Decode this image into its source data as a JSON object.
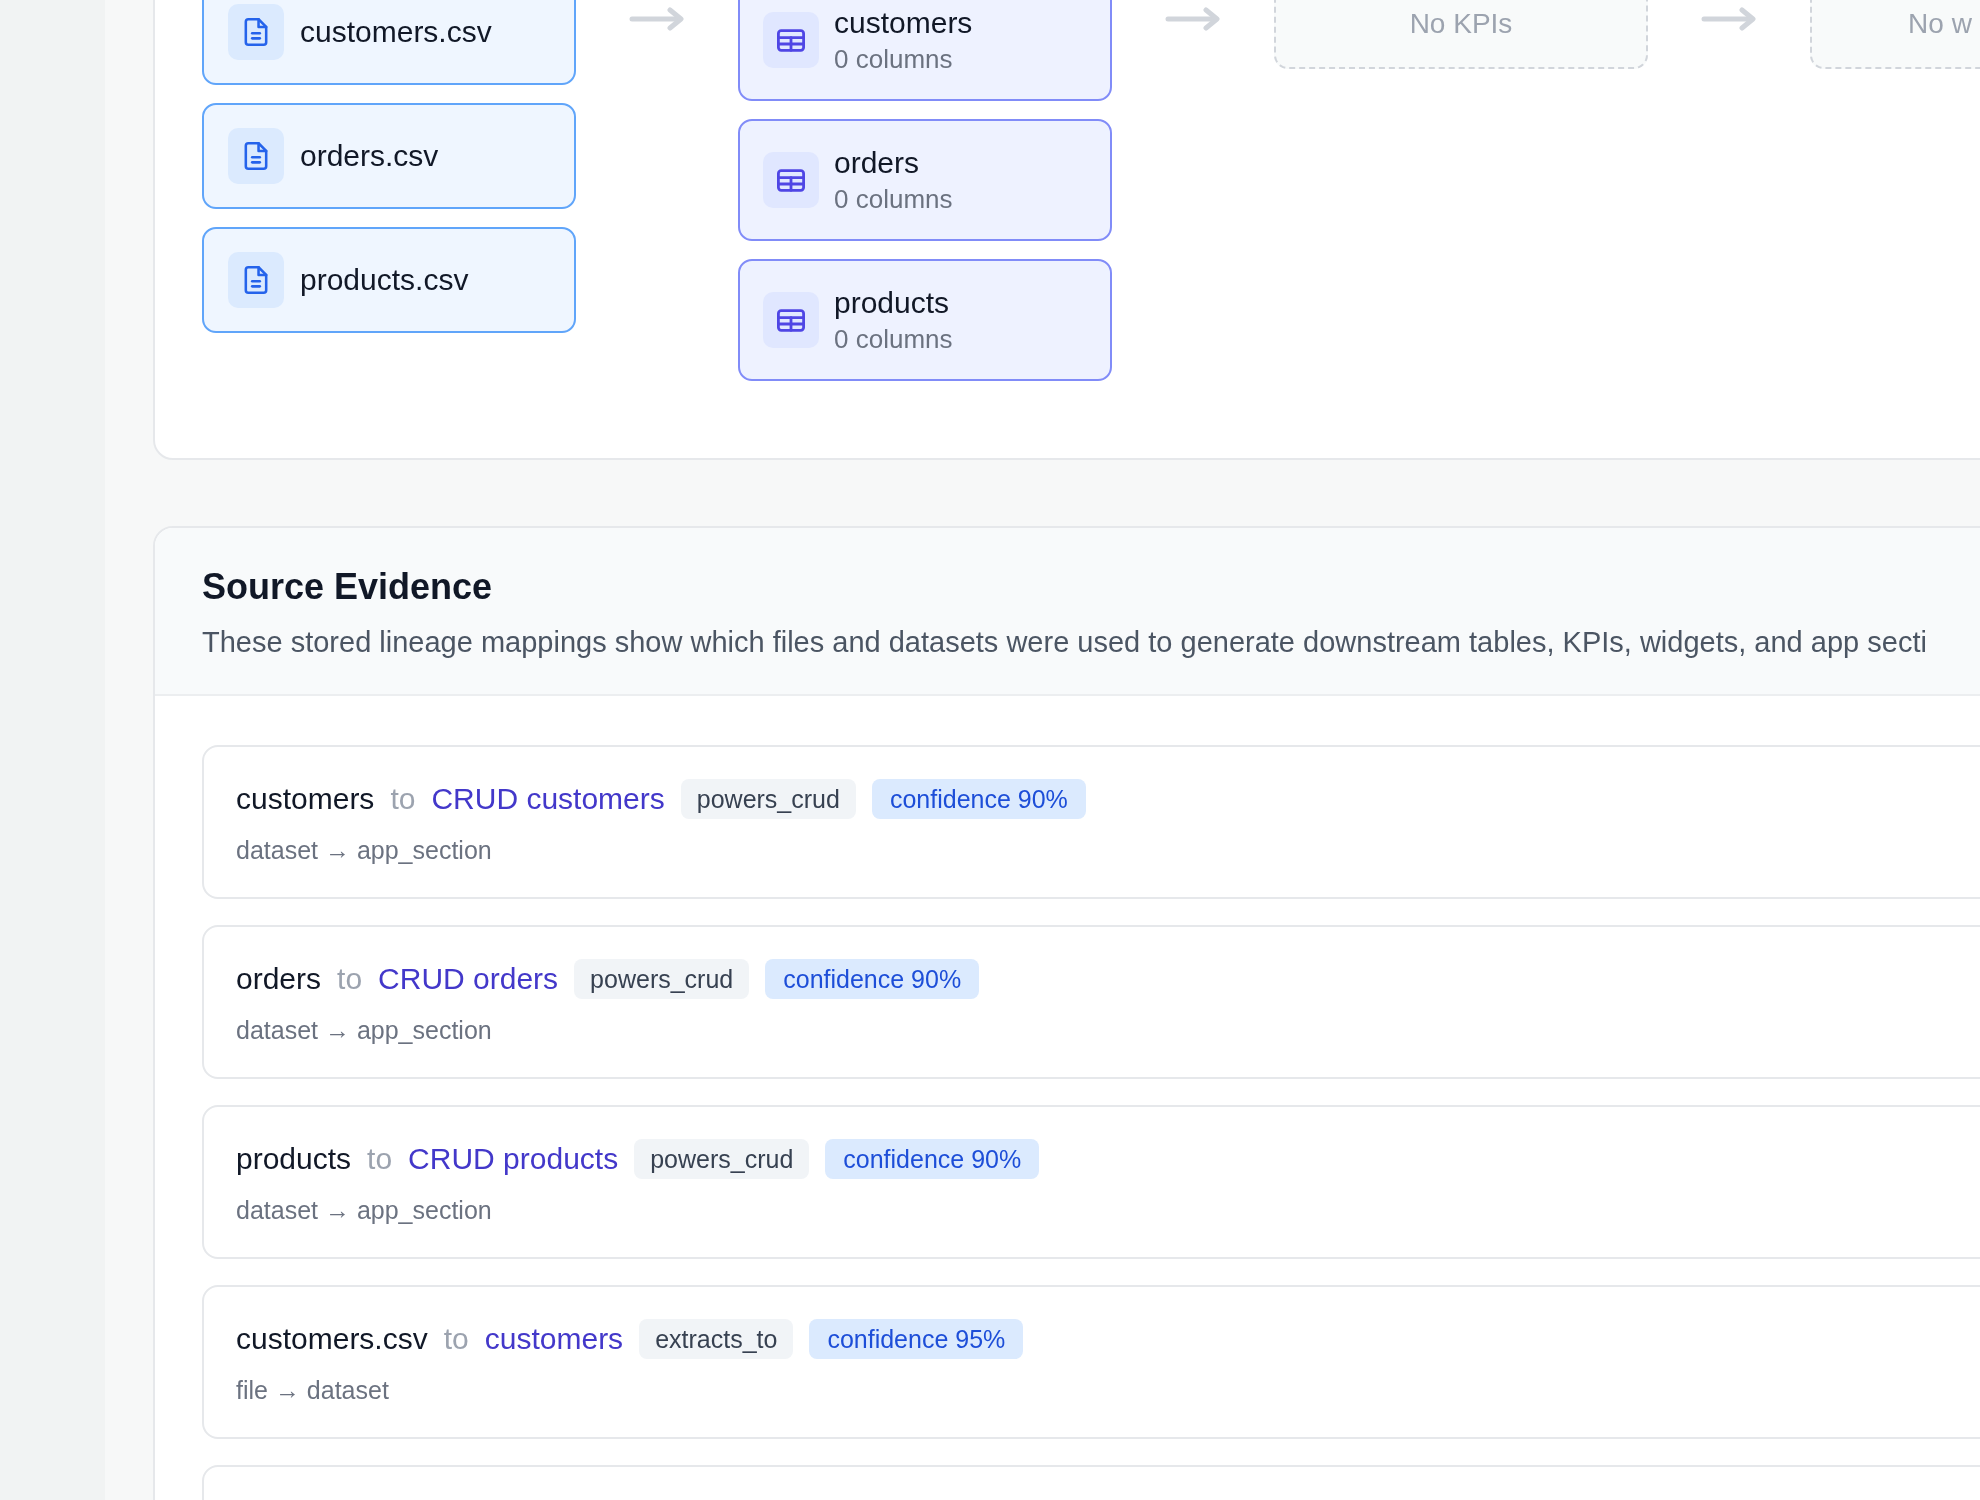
{
  "pipeline": {
    "columns": [
      {
        "kind": "files",
        "items": [
          {
            "label": "customers.csv"
          },
          {
            "label": "orders.csv"
          },
          {
            "label": "products.csv"
          }
        ]
      },
      {
        "kind": "datasets",
        "items": [
          {
            "label": "customers",
            "detail": "0 columns"
          },
          {
            "label": "orders",
            "detail": "0 columns"
          },
          {
            "label": "products",
            "detail": "0 columns"
          }
        ]
      },
      {
        "kind": "empty",
        "message": "No KPIs"
      },
      {
        "kind": "empty",
        "message": "No w"
      }
    ]
  },
  "evidence": {
    "title": "Source Evidence",
    "description": "These stored lineage mappings show which files and datasets were used to generate downstream tables, KPIs, widgets, and app secti",
    "rows": [
      {
        "source": "customers",
        "connector": "to",
        "target": "CRUD customers",
        "relation": "powers_crud",
        "confidence": "confidence 90%",
        "path": "dataset → app_section"
      },
      {
        "source": "orders",
        "connector": "to",
        "target": "CRUD orders",
        "relation": "powers_crud",
        "confidence": "confidence 90%",
        "path": "dataset → app_section"
      },
      {
        "source": "products",
        "connector": "to",
        "target": "CRUD products",
        "relation": "powers_crud",
        "confidence": "confidence 90%",
        "path": "dataset → app_section"
      },
      {
        "source": "customers.csv",
        "connector": "to",
        "target": "customers",
        "relation": "extracts_to",
        "confidence": "confidence 95%",
        "path": "file → dataset"
      }
    ],
    "partial_row_below": true
  }
}
